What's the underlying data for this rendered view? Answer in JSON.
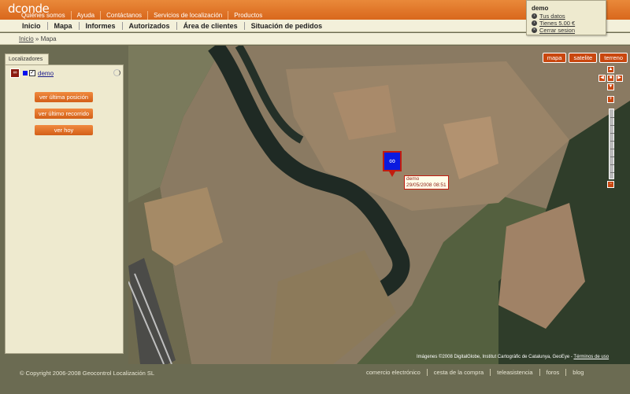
{
  "app": {
    "logo": "dconde",
    "top_nav": [
      "Quiénes somos",
      "Ayuda",
      "Contáctanos",
      "Servicios de localización",
      "Productos"
    ],
    "main_nav": [
      "Inicio",
      "Mapa",
      "Informes",
      "Autorizados",
      "Área de clientes",
      "Situación de pedidos"
    ],
    "breadcrumb": {
      "home": "Inicio",
      "separator": "»",
      "current": "Mapa"
    }
  },
  "user": {
    "name": "demo",
    "links": [
      "Tus datos",
      "Tienes 5.00 €",
      "Cerrar sesion"
    ]
  },
  "sidebar": {
    "tab_label": "Localizadores",
    "locator": {
      "name": "demo",
      "checked": true,
      "color": "#0011ee"
    },
    "buttons": [
      "ver última posición",
      "ver último recorrido",
      "ver hoy"
    ]
  },
  "map": {
    "types": [
      "mapa",
      "satelite",
      "terreno"
    ],
    "marker": {
      "label": "demo",
      "timestamp": "29/05/2008 08:51"
    },
    "attribution": "Imágenes ©2008 DigitalGlobe, Institut Cartogràfic de Catalunya, GeoEye -",
    "terms_label": "Términos de uso"
  },
  "footer": {
    "copyright": "© Copyright 2006-2008 Geocontrol Localización SL",
    "links": [
      "comercio electrónico",
      "cesta de la compra",
      "teleasistencia",
      "foros",
      "blog"
    ]
  },
  "colors": {
    "accent": "#d9671c",
    "panel": "#eeeacf",
    "background": "#6b6b52",
    "marker": "#0a1ae0"
  }
}
